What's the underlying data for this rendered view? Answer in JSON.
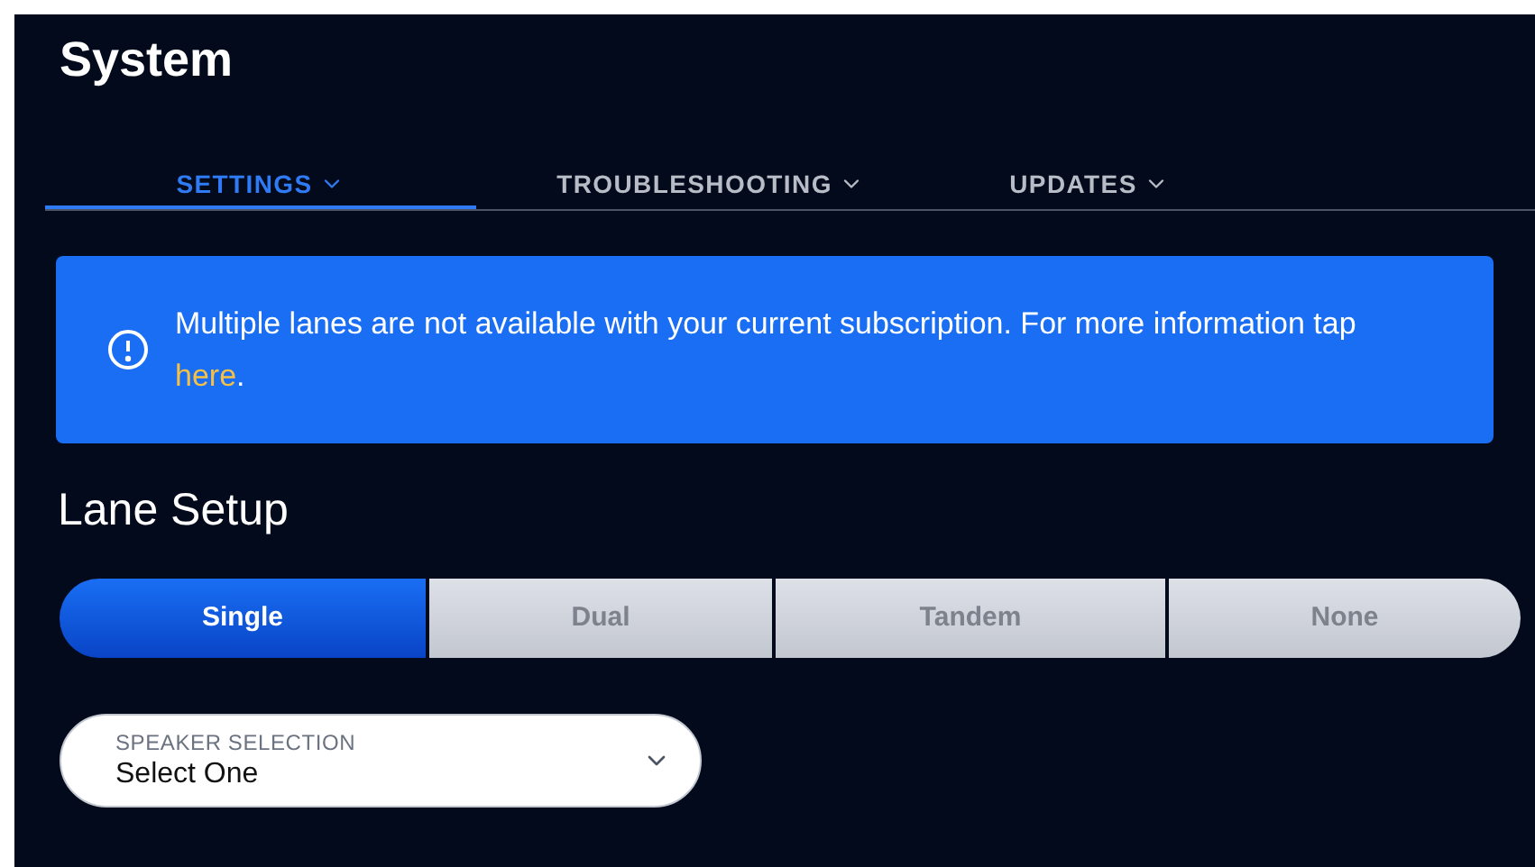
{
  "title": "System",
  "tabs": [
    {
      "label": "SETTINGS",
      "selected": true
    },
    {
      "label": "TROUBLESHOOTING",
      "selected": false
    },
    {
      "label": "UPDATES",
      "selected": false
    }
  ],
  "alert": {
    "text": "Multiple lanes are not available with your current subscription. For more information tap ",
    "link": "here",
    "after": "."
  },
  "section_title": "Lane Setup",
  "lane_options": [
    {
      "label": "Single",
      "selected": true
    },
    {
      "label": "Dual",
      "selected": false
    },
    {
      "label": "Tandem",
      "selected": false
    },
    {
      "label": "None",
      "selected": false
    }
  ],
  "speaker_select": {
    "label": "SPEAKER SELECTION",
    "value": "Select One"
  }
}
